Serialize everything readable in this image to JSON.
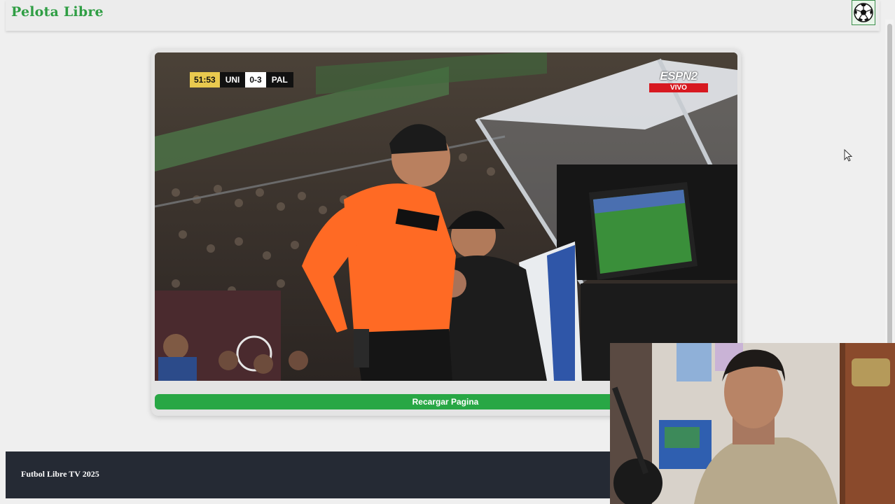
{
  "header": {
    "brand": "Pelota Libre",
    "menu_icon": "soccer-ball-icon"
  },
  "video": {
    "scoreboard": {
      "clock": "51:53",
      "home": "UNI",
      "score": "0-3",
      "away": "PAL"
    },
    "broadcaster": {
      "name": "ESPN2",
      "live": "VIVO"
    }
  },
  "controls": {
    "reload_label": "Recargar Pagina"
  },
  "footer": {
    "text": "Futbol Libre TV 2025"
  },
  "colors": {
    "brand": "#2f9e44",
    "button": "#28a745",
    "footer_bg": "#252a34"
  }
}
